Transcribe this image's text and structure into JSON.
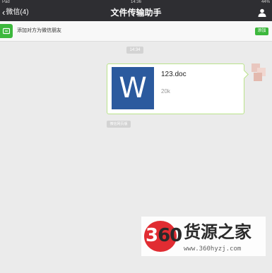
{
  "status_bar": {
    "carrier": "Pad",
    "time": "14:36",
    "battery": "44%"
  },
  "nav": {
    "back_label": "微信(4)",
    "title": "文件传输助手",
    "profile_icon": "person-icon"
  },
  "add_friend_bar": {
    "text": "添加对方为微信朋友",
    "button_label": "添加",
    "icon": "add-contact-icon",
    "accent": "#3db83d"
  },
  "chat": {
    "time": "14:34",
    "file": {
      "name": "123.doc",
      "size": "20k",
      "icon_letter": "W",
      "icon_color": "#2b5a9e"
    },
    "reply_chip": "微信网页版"
  },
  "watermark": {
    "logo_number": "360",
    "brand": "货源之家",
    "url": "www.360hyzj.com"
  }
}
